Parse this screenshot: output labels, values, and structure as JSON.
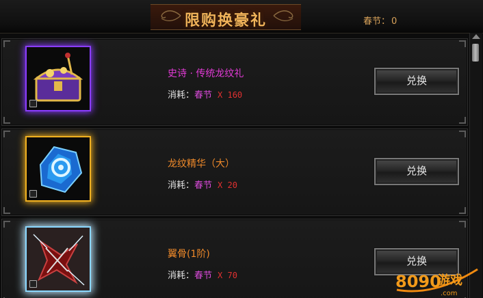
{
  "header": {
    "title": "限购换豪礼",
    "points_label": "春节：",
    "points_value": "0"
  },
  "items": [
    {
      "name": "史诗 · 传统龙纹礼",
      "name_color": "#e23ad6",
      "frame_color": "#8a3cff",
      "icon": "treasure-chest-icon",
      "cost_label": "消耗：",
      "cost_currency": "春节",
      "cost_amount": "X 160",
      "button_label": "兑换"
    },
    {
      "name": "龙纹精华（大）",
      "name_color": "#f08a2a",
      "frame_color": "#f0b020",
      "icon": "blue-crystal-icon",
      "cost_label": "消耗：",
      "cost_currency": "春节",
      "cost_amount": "X 20",
      "button_label": "兑换"
    },
    {
      "name": "翼骨(1阶)",
      "name_color": "#f08a2a",
      "frame_color": "#8ad8ff",
      "icon": "wing-bone-icon",
      "cost_label": "消耗：",
      "cost_currency": "春节",
      "cost_amount": "X 70",
      "button_label": "兑换"
    }
  ],
  "watermark": {
    "number": "8090",
    "text": "游戏",
    "domain": ".com"
  }
}
